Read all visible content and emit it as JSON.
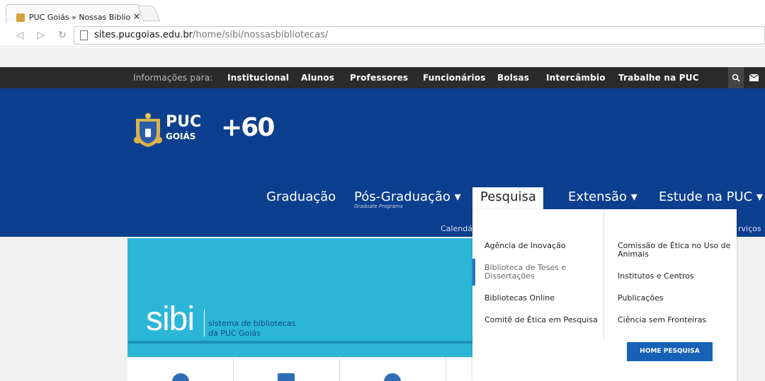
{
  "browser": {
    "tab_title": "PUC Goiás » Nossas Biblio",
    "tab_close": "×",
    "url_domain": "sites.pucgoias.edu.br",
    "url_path": "/home/sibi/nossasbibliotecas/",
    "icons": [
      "back-icon",
      "forward-icon",
      "reload-icon",
      "page-icon"
    ]
  },
  "infobar": {
    "label": "Informações para:",
    "items": [
      "Institucional",
      "Alunos",
      "Professores",
      "Funcionários",
      "Bolsas",
      "Intercâmbio",
      "Trabalhe na PUC"
    ],
    "search_glyph": "🔍",
    "mail_glyph": "✉"
  },
  "header": {
    "logo_puc": "PUC",
    "logo_goias": "GOIÁS",
    "logo_60": "+60",
    "nav": [
      "Graduação",
      "Pós-Graduação ▾",
      "Pesquisa",
      "Extensão ▾",
      "Estude na PUC ▾"
    ],
    "nav_sub": "Graduate Programs",
    "subnav_left": "Calendá",
    "subnav_right": "rviços",
    "colors": {
      "header_bg": "#0c3f8e",
      "infobar_bg": "#2b2b2b"
    }
  },
  "banner": {
    "title": "sibi",
    "subtitle_1a": "sistema ",
    "subtitle_1b": "de",
    "subtitle_1c": " bibliotecas",
    "subtitle_2a": "da",
    "subtitle_2b": " PUC Goiás",
    "colors": {
      "banner_bg": "#2bb6d8"
    }
  },
  "dropdown": {
    "left": [
      "Agência de Inovação",
      "Biblioteca de Teses e Dissertações",
      "Bibliotecas Online",
      "Comitê de Ética em Pesquisa"
    ],
    "right": [
      "Comissão de Ética no Uso de Animais",
      "Institutos e Centros",
      "Publicações",
      "Ciência sem Fronteiras"
    ],
    "button": "HOME PESQUISA"
  }
}
